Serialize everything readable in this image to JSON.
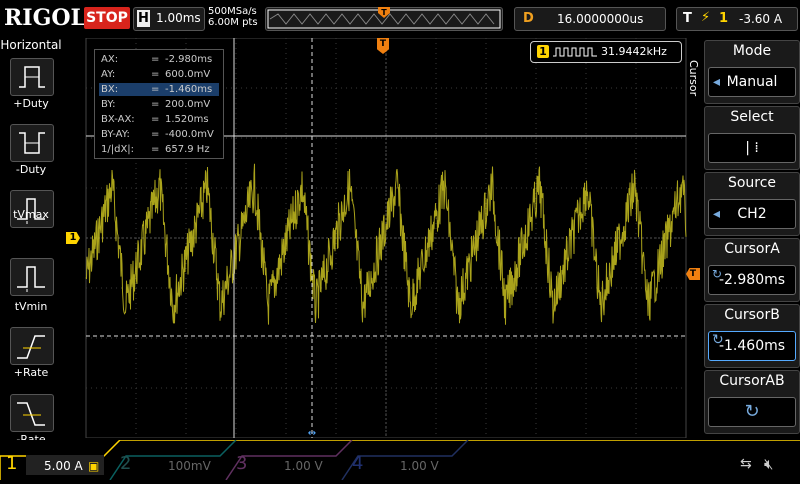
{
  "brand": "RIGOL",
  "run_state": "STOP",
  "horizontal": {
    "key": "H",
    "timebase": "1.00ms",
    "sample_rate": "500MSa/s",
    "points": "6.00M pts"
  },
  "delay": {
    "key": "D",
    "value": "16.0000000us"
  },
  "trigger": {
    "key": "T",
    "edge_icon": "rising-edge-icon",
    "channel": "1",
    "level": "-3.60 A"
  },
  "left_menu": {
    "title": "Horizontal",
    "items": [
      {
        "label": "+Duty"
      },
      {
        "label": "-Duty"
      },
      {
        "label": "tVmax"
      },
      {
        "label": "tVmin"
      },
      {
        "label": "+Rate"
      },
      {
        "label": "-Rate"
      }
    ]
  },
  "measurements": [
    {
      "key": "AX:",
      "eq": "=",
      "value": "-2.980ms"
    },
    {
      "key": "AY:",
      "eq": "=",
      "value": "600.0mV"
    },
    {
      "key": "BX:",
      "eq": "=",
      "value": "-1.460ms"
    },
    {
      "key": "BY:",
      "eq": "=",
      "value": "200.0mV"
    },
    {
      "key": "BX-AX:",
      "eq": "=",
      "value": "1.520ms"
    },
    {
      "key": "BY-AY:",
      "eq": "=",
      "value": "-400.0mV"
    },
    {
      "key": "1/|dX|:",
      "eq": "=",
      "value": "657.9 Hz"
    }
  ],
  "frequency": {
    "channel": "1",
    "value": "31.9442kHz"
  },
  "right_menu": {
    "side_label": "Cursor",
    "mode": {
      "title": "Mode",
      "value": "Manual"
    },
    "select": {
      "title": "Select",
      "value": "| ⁞"
    },
    "source": {
      "title": "Source",
      "value": "CH2"
    },
    "cursor_a": {
      "title": "CursorA",
      "value": "-2.980ms"
    },
    "cursor_b": {
      "title": "CursorB",
      "value": "-1.460ms"
    },
    "cursor_ab": {
      "title": "CursorAB"
    }
  },
  "channels": [
    {
      "num": "1",
      "scale": "5.00 A",
      "color": "#ffd400"
    },
    {
      "num": "2",
      "scale": "100mV",
      "color": "#00e0ff"
    },
    {
      "num": "3",
      "scale": "1.00 V",
      "color": "#e040e0"
    },
    {
      "num": "4",
      "scale": "1.00 V",
      "color": "#3060ff"
    }
  ],
  "markers": {
    "ch1_ground": "1",
    "trigger_level": "T",
    "trigger_pos": "T"
  },
  "colors": {
    "trace": "#c8c020",
    "accent_orange": "#f08010",
    "ch1": "#ffd400"
  }
}
